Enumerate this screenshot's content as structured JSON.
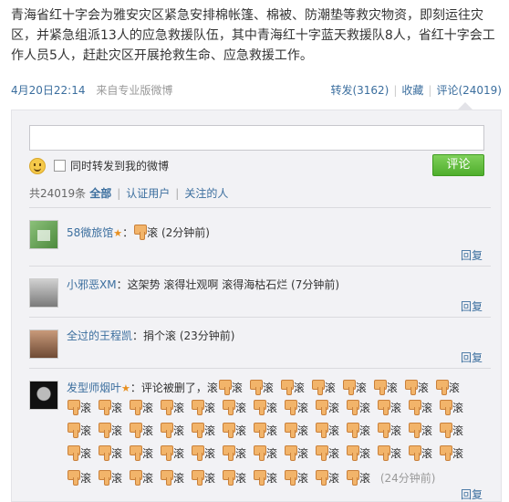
{
  "post": {
    "text": "青海省红十字会为雅安灾区紧急安排棉帐篷、棉被、防潮垫等救灾物资，即刻运往灾区，并紧急组派13人的应急救援队伍，其中青海红十字蓝天救援队8人，省红十字会工作人员5人，赶赴灾区开展抢救生命、应急救援工作。",
    "time": "4月20日22:14",
    "source": "来自专业版微博",
    "repost": "转发(3162)",
    "favorite": "收藏",
    "comment": "评论(24019)"
  },
  "composer": {
    "input_value": "",
    "forward_label": "同时转发到我的微博",
    "submit_label": "评论"
  },
  "filter": {
    "count": "共24019条",
    "all": "全部",
    "verified": "认证用户",
    "following": "关注的人"
  },
  "comments": [
    {
      "user": "58微旅馆",
      "star": "★",
      "sep": "：",
      "text": "滚 (2分钟前)",
      "reply": "回复"
    },
    {
      "user": "小邪恶XM",
      "sep": "：",
      "text": "这架势 滚得壮观啊 滚得海枯石烂 (7分钟前)",
      "reply": "回复"
    },
    {
      "user": "全过的王程凯",
      "sep": "：",
      "text": "捐个滚 (23分钟前)",
      "reply": "回复"
    },
    {
      "user": "发型师烟叶",
      "star": "★",
      "sep": "：",
      "text": "评论被删了，滚",
      "roll": "滚",
      "time": "(24分钟前)",
      "reply": "回复"
    }
  ],
  "colors": {
    "link": "#3b6e9e",
    "submit": "#4fae2c",
    "box": "#f2f2f5"
  }
}
